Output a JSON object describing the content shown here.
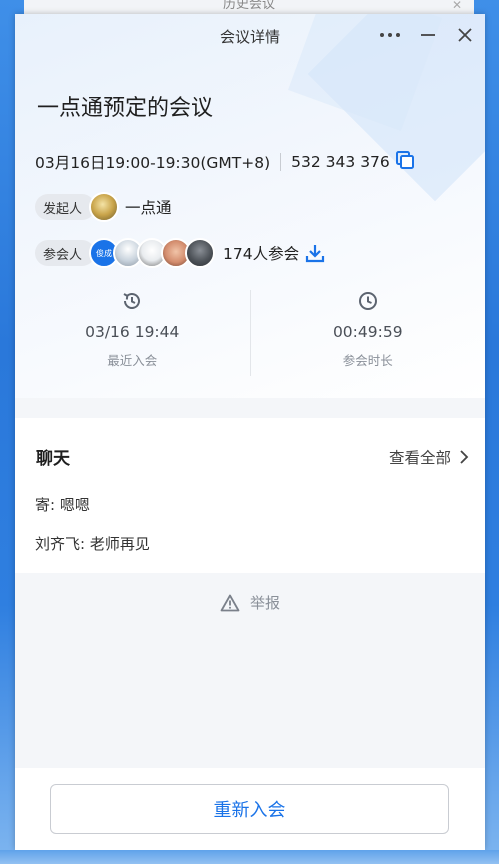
{
  "background_window": {
    "title": "历史会议",
    "close_glyph": "✕"
  },
  "window": {
    "title": "会议详情",
    "controls": {
      "more": "•••",
      "minimize": "—",
      "close": "✕"
    }
  },
  "meeting": {
    "title": "一点通预定的会议",
    "time": "03月16日19:00-19:30(GMT+8)",
    "meeting_id": "532 343 376"
  },
  "initiator": {
    "label": "发起人",
    "name": "一点通"
  },
  "participants": {
    "label": "参会人",
    "first_avatar_text": "俊成",
    "count_text": "174人参会"
  },
  "stats": {
    "last_join": {
      "value": "03/16 19:44",
      "label": "最近入会"
    },
    "duration": {
      "value": "00:49:59",
      "label": "参会时长"
    }
  },
  "chat": {
    "title": "聊天",
    "view_all": "查看全部",
    "messages": [
      {
        "text": "寄: 嗯嗯"
      },
      {
        "text": "刘齐飞: 老师再见"
      }
    ]
  },
  "report": {
    "label": "举报"
  },
  "footer": {
    "rejoin_label": "重新入会"
  },
  "colors": {
    "accent": "#1a73e8",
    "text_primary": "#1f1f1f",
    "text_muted": "#8a9099"
  }
}
